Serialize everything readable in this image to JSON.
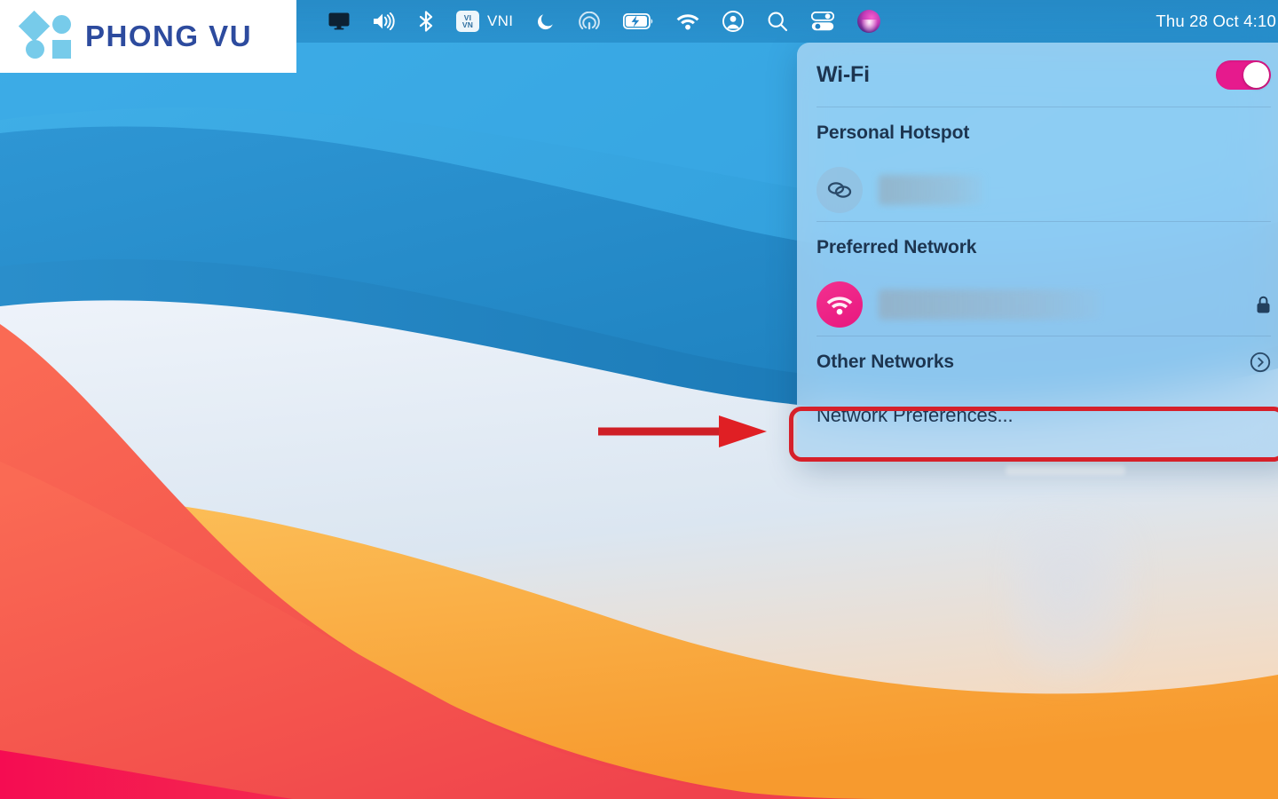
{
  "brand": {
    "name": "PHONG VU",
    "mark_color": "#77cbea",
    "text_color": "#2d4b9e"
  },
  "menubar": {
    "background_color": "#1676b2",
    "icons": [
      {
        "name": "display-mirroring-icon",
        "label": "Screen Mirroring"
      },
      {
        "name": "volume-icon",
        "label": "Volume"
      },
      {
        "name": "bluetooth-icon",
        "label": "Bluetooth"
      },
      {
        "name": "vni-input-icon",
        "label": "VNI",
        "badge_top": "VI",
        "badge_bottom": "VN"
      },
      {
        "name": "do-not-disturb-icon",
        "label": "Do Not Disturb"
      },
      {
        "name": "airdrop-icon",
        "label": "AirDrop"
      },
      {
        "name": "battery-charging-icon",
        "label": "Battery"
      },
      {
        "name": "wifi-icon",
        "label": "Wi-Fi"
      },
      {
        "name": "user-account-icon",
        "label": "Fast User Switching"
      },
      {
        "name": "spotlight-search-icon",
        "label": "Spotlight Search"
      },
      {
        "name": "control-center-icon",
        "label": "Control Center"
      },
      {
        "name": "siri-icon",
        "label": "Siri"
      }
    ],
    "clock": "Thu 28 Oct  4:10"
  },
  "wifi_panel": {
    "header": {
      "title": "Wi-Fi",
      "toggle_state": "on",
      "toggle_color": "#e61a8d"
    },
    "sections": [
      {
        "label": "Personal Hotspot",
        "rows": [
          {
            "icon": "hotspot-link-icon",
            "name_redacted": true,
            "name": "",
            "trailing_icon": ""
          }
        ]
      },
      {
        "label": "Preferred Network",
        "rows": [
          {
            "icon": "wifi-connected-icon",
            "name_redacted": true,
            "name": "",
            "trailing_icon": "lock-icon"
          }
        ]
      },
      {
        "label": "Other Networks",
        "trailing_icon": "chevron-right-circle-icon",
        "rows": []
      }
    ],
    "footer": {
      "network_preferences_label": "Network Preferences...",
      "highlighted": true
    }
  },
  "annotations": {
    "highlight_color": "#d6202a",
    "arrow_target": "Network Preferences...",
    "arrow_direction": "right"
  },
  "wallpaper": {
    "name": "macOS Big Sur",
    "colors": {
      "sky_top": "#2ba0e0",
      "sky_mid": "#2b8fcc",
      "sky_deep": "#1f7fbd",
      "haze": "#dfe8f2",
      "red": "#f4564c",
      "orange": "#f9a83a",
      "crimson": "#f01347"
    }
  }
}
